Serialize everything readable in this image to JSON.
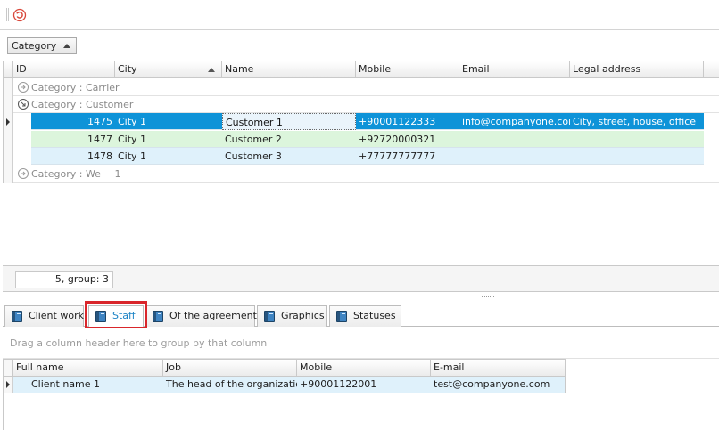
{
  "toolbar": {
    "refresh_icon": "refresh-icon"
  },
  "top_grid": {
    "group_by_chip": "Category",
    "columns": [
      "ID",
      "City",
      "Name",
      "Mobile",
      "Email",
      "Legal address"
    ],
    "groups": {
      "carrier": "Category : Carrier",
      "customer": "Category : Customer",
      "we": "Category : We",
      "we_count": "1"
    },
    "rows": [
      {
        "id": "1475",
        "city": "City 1",
        "name": "Customer 1",
        "mobile": "+90001122333",
        "email": "info@companyone.com",
        "address": "City, street, house, office"
      },
      {
        "id": "1477",
        "city": "City 1",
        "name": "Customer 2",
        "mobile": "+92720000321",
        "email": "",
        "address": ""
      },
      {
        "id": "1478",
        "city": "City 1",
        "name": "Customer 3",
        "mobile": "+77777777777",
        "email": "",
        "address": ""
      }
    ],
    "footer_summary": "5, group: 3"
  },
  "tabs": [
    "Client work",
    "Staff",
    "Of the agreement",
    "Graphics",
    "Statuses"
  ],
  "bottom_grid": {
    "group_hint": "Drag a column header here to group by that column",
    "columns": [
      "Full name",
      "Job",
      "Mobile",
      "E-mail"
    ],
    "rows": [
      {
        "full_name": "Client name 1",
        "job": "The head of the organization",
        "mobile": "+90001122001",
        "email": "test@companyone.com"
      }
    ]
  },
  "colors": {
    "selection": "#0e93d8",
    "active_tab_text": "#1d84c6",
    "highlight": "#d9262b"
  }
}
